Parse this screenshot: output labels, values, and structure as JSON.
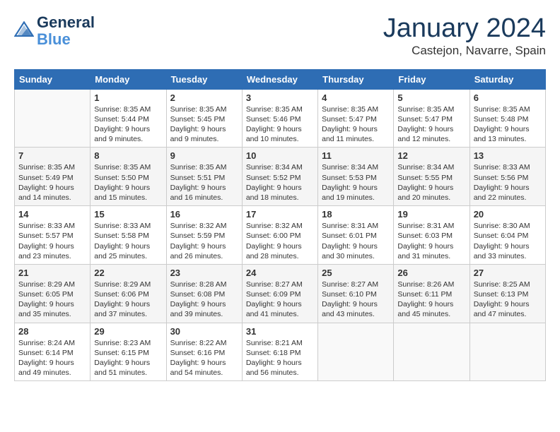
{
  "header": {
    "logo_line1": "General",
    "logo_line2": "Blue",
    "month_title": "January 2024",
    "location": "Castejon, Navarre, Spain"
  },
  "days_of_week": [
    "Sunday",
    "Monday",
    "Tuesday",
    "Wednesday",
    "Thursday",
    "Friday",
    "Saturday"
  ],
  "weeks": [
    [
      {
        "day": "",
        "info": ""
      },
      {
        "day": "1",
        "info": "Sunrise: 8:35 AM\nSunset: 5:44 PM\nDaylight: 9 hours\nand 9 minutes."
      },
      {
        "day": "2",
        "info": "Sunrise: 8:35 AM\nSunset: 5:45 PM\nDaylight: 9 hours\nand 9 minutes."
      },
      {
        "day": "3",
        "info": "Sunrise: 8:35 AM\nSunset: 5:46 PM\nDaylight: 9 hours\nand 10 minutes."
      },
      {
        "day": "4",
        "info": "Sunrise: 8:35 AM\nSunset: 5:47 PM\nDaylight: 9 hours\nand 11 minutes."
      },
      {
        "day": "5",
        "info": "Sunrise: 8:35 AM\nSunset: 5:47 PM\nDaylight: 9 hours\nand 12 minutes."
      },
      {
        "day": "6",
        "info": "Sunrise: 8:35 AM\nSunset: 5:48 PM\nDaylight: 9 hours\nand 13 minutes."
      }
    ],
    [
      {
        "day": "7",
        "info": "Sunrise: 8:35 AM\nSunset: 5:49 PM\nDaylight: 9 hours\nand 14 minutes."
      },
      {
        "day": "8",
        "info": "Sunrise: 8:35 AM\nSunset: 5:50 PM\nDaylight: 9 hours\nand 15 minutes."
      },
      {
        "day": "9",
        "info": "Sunrise: 8:35 AM\nSunset: 5:51 PM\nDaylight: 9 hours\nand 16 minutes."
      },
      {
        "day": "10",
        "info": "Sunrise: 8:34 AM\nSunset: 5:52 PM\nDaylight: 9 hours\nand 18 minutes."
      },
      {
        "day": "11",
        "info": "Sunrise: 8:34 AM\nSunset: 5:53 PM\nDaylight: 9 hours\nand 19 minutes."
      },
      {
        "day": "12",
        "info": "Sunrise: 8:34 AM\nSunset: 5:55 PM\nDaylight: 9 hours\nand 20 minutes."
      },
      {
        "day": "13",
        "info": "Sunrise: 8:33 AM\nSunset: 5:56 PM\nDaylight: 9 hours\nand 22 minutes."
      }
    ],
    [
      {
        "day": "14",
        "info": "Sunrise: 8:33 AM\nSunset: 5:57 PM\nDaylight: 9 hours\nand 23 minutes."
      },
      {
        "day": "15",
        "info": "Sunrise: 8:33 AM\nSunset: 5:58 PM\nDaylight: 9 hours\nand 25 minutes."
      },
      {
        "day": "16",
        "info": "Sunrise: 8:32 AM\nSunset: 5:59 PM\nDaylight: 9 hours\nand 26 minutes."
      },
      {
        "day": "17",
        "info": "Sunrise: 8:32 AM\nSunset: 6:00 PM\nDaylight: 9 hours\nand 28 minutes."
      },
      {
        "day": "18",
        "info": "Sunrise: 8:31 AM\nSunset: 6:01 PM\nDaylight: 9 hours\nand 30 minutes."
      },
      {
        "day": "19",
        "info": "Sunrise: 8:31 AM\nSunset: 6:03 PM\nDaylight: 9 hours\nand 31 minutes."
      },
      {
        "day": "20",
        "info": "Sunrise: 8:30 AM\nSunset: 6:04 PM\nDaylight: 9 hours\nand 33 minutes."
      }
    ],
    [
      {
        "day": "21",
        "info": "Sunrise: 8:29 AM\nSunset: 6:05 PM\nDaylight: 9 hours\nand 35 minutes."
      },
      {
        "day": "22",
        "info": "Sunrise: 8:29 AM\nSunset: 6:06 PM\nDaylight: 9 hours\nand 37 minutes."
      },
      {
        "day": "23",
        "info": "Sunrise: 8:28 AM\nSunset: 6:08 PM\nDaylight: 9 hours\nand 39 minutes."
      },
      {
        "day": "24",
        "info": "Sunrise: 8:27 AM\nSunset: 6:09 PM\nDaylight: 9 hours\nand 41 minutes."
      },
      {
        "day": "25",
        "info": "Sunrise: 8:27 AM\nSunset: 6:10 PM\nDaylight: 9 hours\nand 43 minutes."
      },
      {
        "day": "26",
        "info": "Sunrise: 8:26 AM\nSunset: 6:11 PM\nDaylight: 9 hours\nand 45 minutes."
      },
      {
        "day": "27",
        "info": "Sunrise: 8:25 AM\nSunset: 6:13 PM\nDaylight: 9 hours\nand 47 minutes."
      }
    ],
    [
      {
        "day": "28",
        "info": "Sunrise: 8:24 AM\nSunset: 6:14 PM\nDaylight: 9 hours\nand 49 minutes."
      },
      {
        "day": "29",
        "info": "Sunrise: 8:23 AM\nSunset: 6:15 PM\nDaylight: 9 hours\nand 51 minutes."
      },
      {
        "day": "30",
        "info": "Sunrise: 8:22 AM\nSunset: 6:16 PM\nDaylight: 9 hours\nand 54 minutes."
      },
      {
        "day": "31",
        "info": "Sunrise: 8:21 AM\nSunset: 6:18 PM\nDaylight: 9 hours\nand 56 minutes."
      },
      {
        "day": "",
        "info": ""
      },
      {
        "day": "",
        "info": ""
      },
      {
        "day": "",
        "info": ""
      }
    ]
  ]
}
